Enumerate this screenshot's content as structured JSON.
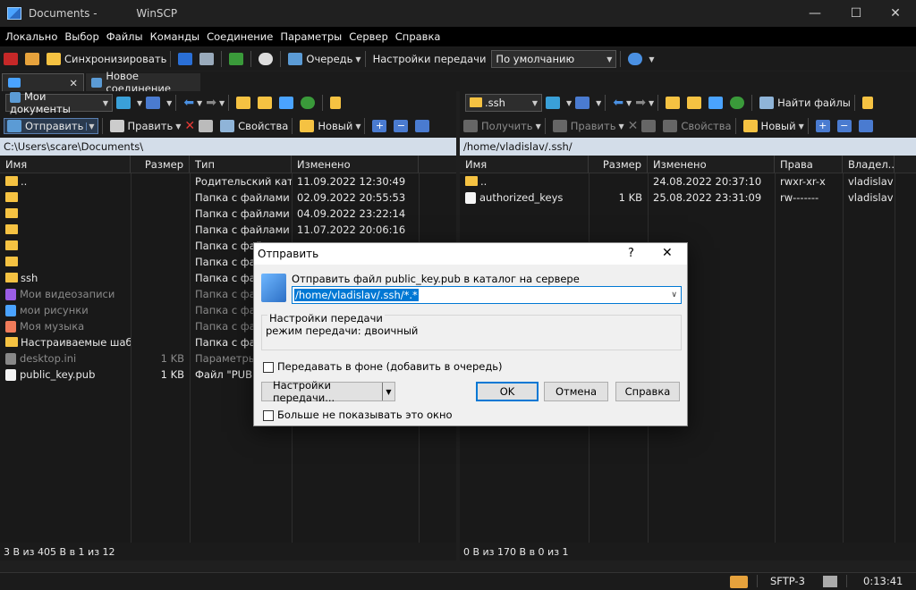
{
  "window": {
    "title": "Documents - ",
    "app": "WinSCP",
    "btn_min": "—",
    "btn_max": "☐",
    "btn_close": "✕"
  },
  "menu": [
    "Локально",
    "Выбор",
    "Файлы",
    "Команды",
    "Соединение",
    "Параметры",
    "Сервер",
    "Справка"
  ],
  "toolbar": {
    "sync": "Синхронизировать",
    "queue": "Очередь",
    "transfer_settings": "Настройки передачи",
    "transfer_mode": "По умолчанию"
  },
  "tabs": {
    "new_session": "Новое соединение"
  },
  "left": {
    "location": "Мои документы",
    "send": "Отправить",
    "edit": "Править",
    "properties": "Свойства",
    "new": "Новый",
    "path": "C:\\Users\\scare\\Documents\\",
    "columns": {
      "name": "Имя",
      "size": "Размер",
      "type": "Тип",
      "changed": "Изменено"
    },
    "rows": [
      {
        "name": "..",
        "size": "",
        "type": "Родительский кат...",
        "changed": "11.09.2022  12:30:49",
        "icon": "folder-up-icon",
        "dim": false
      },
      {
        "name": "",
        "size": "",
        "type": "Папка с файлами",
        "changed": "02.09.2022  20:55:53",
        "icon": "folder-icon",
        "dim": false
      },
      {
        "name": "",
        "size": "",
        "type": "Папка с файлами",
        "changed": "04.09.2022  23:22:14",
        "icon": "folder-icon",
        "dim": false
      },
      {
        "name": "",
        "size": "",
        "type": "Папка с файлами",
        "changed": "11.07.2022  20:06:16",
        "icon": "folder-icon",
        "dim": false
      },
      {
        "name": "",
        "size": "",
        "type": "Папка с фай",
        "changed": "",
        "icon": "folder-icon",
        "dim": false
      },
      {
        "name": "",
        "size": "",
        "type": "Папка с фай",
        "changed": "",
        "icon": "folder-icon",
        "dim": false
      },
      {
        "name": "ssh",
        "size": "",
        "type": "Папка с фай",
        "changed": "",
        "icon": "folder-icon",
        "dim": false
      },
      {
        "name": "Мои видеозаписи",
        "size": "",
        "type": "Папка с фай",
        "changed": "",
        "icon": "video-icon",
        "dim": true
      },
      {
        "name": "мои рисунки",
        "size": "",
        "type": "Папка с фай",
        "changed": "",
        "icon": "pictures-icon",
        "dim": true
      },
      {
        "name": "Моя музыка",
        "size": "",
        "type": "Папка с фай",
        "changed": "",
        "icon": "music-icon",
        "dim": true
      },
      {
        "name": "Настраиваемые шаб...",
        "size": "",
        "type": "Папка с фай",
        "changed": "",
        "icon": "folder-icon",
        "dim": false
      },
      {
        "name": "desktop.ini",
        "size": "1 KB",
        "type": "Параметры",
        "changed": "",
        "icon": "settings-file-icon",
        "dim": true
      },
      {
        "name": "public_key.pub",
        "size": "1 KB",
        "type": "Файл \"PUB\"",
        "changed": "",
        "icon": "file-icon",
        "dim": false
      }
    ],
    "status": "3 B из 405 B в 1 из 12"
  },
  "right": {
    "location": ".ssh",
    "download": "Получить",
    "edit": "Править",
    "properties": "Свойства",
    "new": "Новый",
    "find": "Найти файлы",
    "path": "/home/vladislav/.ssh/",
    "columns": {
      "name": "Имя",
      "size": "Размер",
      "changed": "Изменено",
      "rights": "Права",
      "owner": "Владел..."
    },
    "rows": [
      {
        "name": "..",
        "size": "",
        "changed": "24.08.2022 20:37:10",
        "rights": "rwxr-xr-x",
        "owner": "vladislav",
        "icon": "folder-up-icon"
      },
      {
        "name": "authorized_keys",
        "size": "1 KB",
        "changed": "25.08.2022 23:31:09",
        "rights": "rw-------",
        "owner": "vladislav",
        "icon": "file-icon"
      }
    ],
    "status": "0 B из 170 B в 0 из 1"
  },
  "statusbar": {
    "protocol": "SFTP-3",
    "time": "0:13:41"
  },
  "dialog": {
    "title": "Отправить",
    "help": "?",
    "close": "✕",
    "prompt": "Отправить файл public_key.pub в каталог на сервере",
    "target": "/home/vladislav/.ssh/*.*",
    "settings_title": "Настройки передачи",
    "settings_text": "режим передачи: двоичный",
    "background_check": "Передавать в фоне (добавить в очередь)",
    "settings_button": "Настройки передачи...",
    "ok": "OK",
    "cancel": "Отмена",
    "help_button": "Справка",
    "dont_show": "Больше не показывать это окно"
  }
}
